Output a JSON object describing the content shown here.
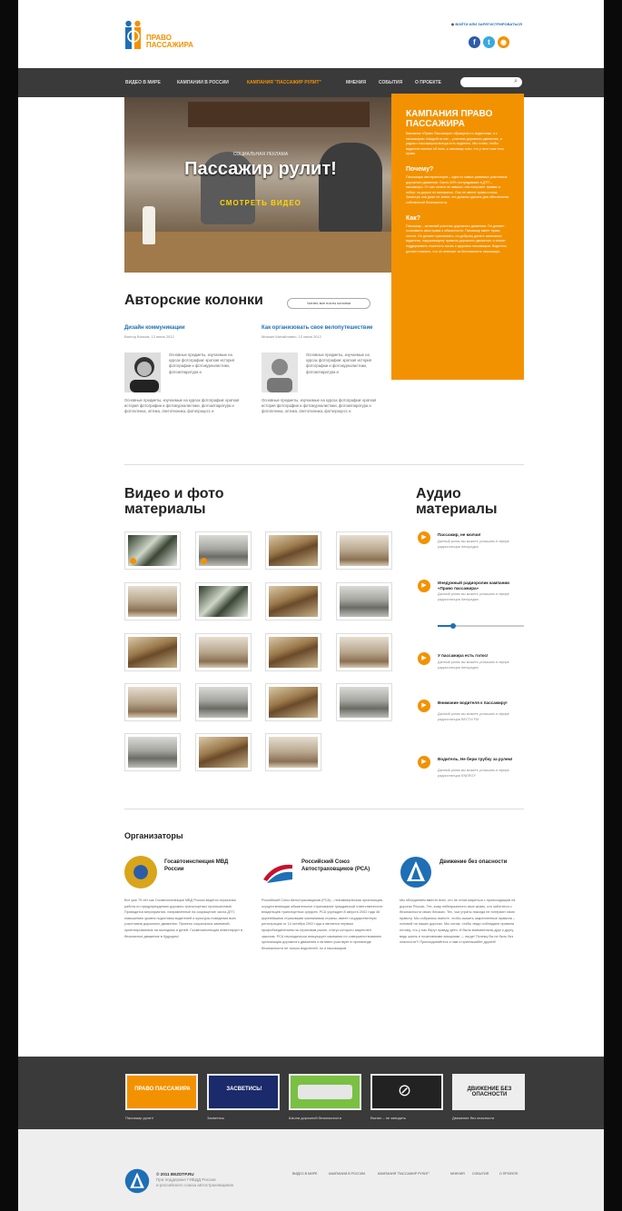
{
  "header": {
    "logo_line1": "ПРАВО",
    "logo_line2": "ПАССАЖИРА",
    "login": "ВОЙТИ ИЛИ ЗАРЕГИСТРИРОВАТЬСЯ",
    "social": [
      {
        "icon": "facebook-icon",
        "color": "#2c5ca8",
        "glyph": "f"
      },
      {
        "icon": "twitter-icon",
        "color": "#38a9e1",
        "glyph": "t"
      },
      {
        "icon": "rss-icon",
        "color": "#f39200",
        "glyph": "r"
      }
    ]
  },
  "nav": {
    "items": [
      "ВИДЕО В МИРЕ",
      "КАМПАНИИ В РОССИИ",
      "КАМПАНИЯ \"ПАССАЖИР РУЛИТ\"",
      "МНЕНИЯ",
      "СОБЫТИЯ",
      "О ПРОЕКТЕ"
    ],
    "active_index": 2,
    "search_placeholder": ""
  },
  "hero": {
    "subtitle": "СОЦИАЛЬНАЯ РЕКЛАМА",
    "title": "Пассажир рулит!",
    "button": "СМОТРЕТЬ ВИДЕО"
  },
  "campaign": {
    "title": "КАМПАНИЯ ПРАВО ПАССАЖИРА",
    "intro": "Кампания «Право Пассажира» обращена и к водителям, и к пассажирам. Каждый из нас – участник дорожного движения, и рядом с пассажиром всегда есть водитель. Мы хотим, чтобы водитель помнил об этом, а пассажир знал, что у него тоже есть права.",
    "why_title": "Почему?",
    "why_text": "Пассажиры автотранспорта – одни из самых уязвимых участников дорожного движения. Около 40% пострадавших в ДТП – пассажиры. От них ничего не зависит, они получают травмы и гибнут на дороге не виноватые. Они не имеют права голоса. Зачастую они даже не знают, что должны сделать для обеспечения собственной безопасности.",
    "how_title": "Как?",
    "how_text": "Пассажир – активный участник дорожного движения. Он должен осознавать свои права и обязанности. Пассажир имеет право голоса. Он должен чувствовать, по-доброму делать замечания водителю, нарушающему правила дорожного движения, и значит поддерживать опасность жизнь и здоровья пассажиров. Водитель должен помнить, что он отвечает за безопасность пассажира."
  },
  "columns": {
    "title": "Авторские колонки",
    "read_all": "Читать все посты колонки",
    "items": [
      {
        "title": "Дизайн коммуникации",
        "byline": "Виктор Волков, 12 июня 2012",
        "text1": "Основные предметы, изучаемые на курсах фотографии: краткая история фотографии и фотожурналистики, фотоаппаратура и",
        "text2": "Основные предметы, изучаемые на курсах фотографии: краткая история фотографии и фотожурналистики, фотоаппаратура и фотопленка, оптика, светотехника, фотопроцесс и"
      },
      {
        "title": "Как организовать свое велопутешествие",
        "byline": "Михаил Михайлович, 12 июня 2012",
        "text1": "Основные предметы, изучаемые на курсах фотографии: краткая история фотографии и фотожурналистики, фотоаппаратура и",
        "text2": "Основные предметы, изучаемые на курсах фотографии: краткая история фотографии и фотожурналистики, фотоаппаратура и фотопленка, оптика, светотехника, фотопроцесс и"
      }
    ]
  },
  "media": {
    "title_line1": "Видео и фото",
    "title_line2": "материалы",
    "rows": [
      [
        "forest",
        "street",
        "moose",
        "kitchen"
      ],
      [
        "kitchen",
        "forest",
        "moose",
        "street"
      ],
      [
        "moose",
        "kitchen",
        "moose",
        "kitchen"
      ],
      [
        "kitchen",
        "street",
        "moose",
        "street"
      ],
      [
        "street",
        "moose",
        "kitchen"
      ]
    ]
  },
  "audio": {
    "title_line1": "Аудио",
    "title_line2": "материалы",
    "items": [
      {
        "title": "Пассажир, не молчи!",
        "desc": "Данный ролик вы можете услышать в эфире радиостанции Авторадио"
      },
      {
        "title": "Инедужный радиоролик кампании «Право пассажира»",
        "desc": "Данный ролик вы можете услышать в эфире радиостанции Авторадио"
      },
      {
        "title": "У пассажира есть голос!",
        "desc": "Данный ролик вы можете услышать в эфире радиостанции Авторадио"
      },
      {
        "title": "Внимание водителя к пассажиру!",
        "desc": "Данный ролик вы можете услышать в эфире радиостанции ВЕСТИ FM"
      },
      {
        "title": "Водитель, Не бери трубку за рулем!",
        "desc": "Данный ролик вы можете услышать в эфире радиостанции ENERGY"
      }
    ],
    "player_progress": 0.18
  },
  "organizers": {
    "title": "Организаторы",
    "items": [
      {
        "name": "Госавтоинспекция МВД России",
        "emblem_color": "#d8a51b",
        "text": "Вот уже 75 лет как Госавтоинспекция МВД России ведется серьезная работа по предупреждению дорожно-транспортных происшествий. Проводятся мероприятия, направленные на сокращение числа ДТП, повышению уровня подготовки водителей и культуры поведения всех участников дорожного движения. Проекты социальных кампаний, ориентированные на молодежь и детей. Госавтоинспекция инвестирует в безопасное движение в будущем!"
      },
      {
        "name": "Российский Союз Автостраховщиков (РСА)",
        "emblem_color": "#1e6fb5",
        "text": "Российский Союз Автостраховщиков (РСА) – некоммерческая организация, осуществляющая обязательное страхование гражданской ответственности владельцев транспортных средств. РСА учрежден 8 августа 2002 года 46 крупнейшими страховыми компаниями страны, имеет государственную регистрацию от 14 октября 2002 года и является первым профобъединением на страховом рынке, статус которого закреплен законом. РСА периодически инициирует кампании по совершенствованию организации дорожного движения и активно участвует в пропаганде безопасности не только водителей, но и пассажиров."
      },
      {
        "name": "Движение без опасности",
        "emblem_color": "#1e6fb5",
        "text": "Мы объединяем вместе всех, кто не готов мириться с происходящим на дорогах России. Тех, кому небезразлично свое жизнь, кто заботится о безопасности своих близких. Тех, чьи утраты никогда не потеряют свою правоту. Мы собрались вместе, чтобы сказать закрепленные правила – основой на наших дорогах. Мы хотим, чтобы люди соблюдали правила потому, что у нас берут правду дети. И были внимательны друг к другу, ведь жизнь и позитивными эмоциями — нигде! Почему бы не быть без опасности?! Присоединяйтесь к нам и приглашайте друзей!"
      }
    ]
  },
  "banners": [
    {
      "caption": "Пассажир рулит!",
      "label": "ПРАВО ПАССАЖИРА",
      "bg": "#f39200"
    },
    {
      "caption": "Засветись",
      "label": "ЗАСВЕТИСЬ!",
      "bg": "#1a2a6a"
    },
    {
      "caption": "Школа дорожной безопасности",
      "label": "",
      "bg": "#7ac043"
    },
    {
      "caption": "Выпил – не заводить",
      "label": "",
      "bg": "#222222"
    },
    {
      "caption": "Движение без опасности",
      "label": "ДВИЖЕНИЕ БЕЗ ОПАСНОСТИ",
      "bg": "#eeeeee"
    }
  ],
  "footer": {
    "copyright": "© 2011 BEZDTP.RU",
    "sub1": "При поддержке ГИБДД России",
    "sub2": "и российского союза автостраховщиков",
    "links": [
      "ВИДЕО В МИРЕ",
      "КАМПАНИИ В РОССИИ",
      "КАМПАНИЯ \"ПАССАЖИР РУЛИТ\"",
      "МНЕНИЯ",
      "СОБЫТИЯ",
      "О ПРОЕКТЕ"
    ]
  }
}
